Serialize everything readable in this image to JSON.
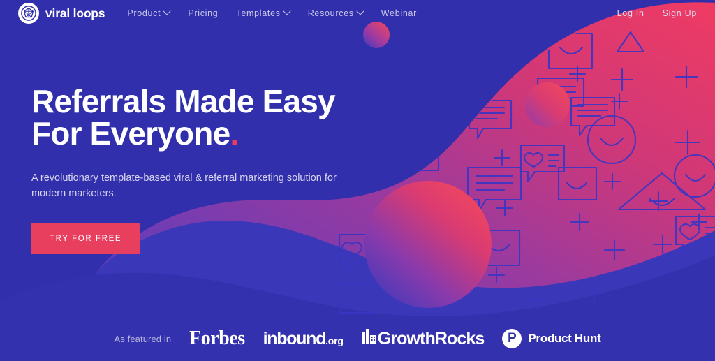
{
  "brand": {
    "name": "viral loops",
    "logo_icon": "gem-logo-icon"
  },
  "nav": {
    "main": [
      {
        "label": "Product",
        "has_dropdown": true
      },
      {
        "label": "Pricing",
        "has_dropdown": false
      },
      {
        "label": "Templates",
        "has_dropdown": true
      },
      {
        "label": "Resources",
        "has_dropdown": true
      },
      {
        "label": "Webinar",
        "has_dropdown": false
      }
    ],
    "right": [
      {
        "label": "Log In"
      },
      {
        "label": "Sign Up"
      }
    ]
  },
  "hero": {
    "headline_line1": "Referrals Made Easy",
    "headline_line2": "For Everyone",
    "headline_dot": ".",
    "subtitle": "A revolutionary template-based viral & referral marketing solution for modern marketers.",
    "cta_label": "TRY FOR FREE"
  },
  "featured": {
    "label": "As featured in",
    "logos": [
      {
        "name": "Forbes"
      },
      {
        "name": "inbound",
        "tld": ".org"
      },
      {
        "name": "GrowthRocks"
      },
      {
        "name": "Product Hunt",
        "badge": "P"
      }
    ]
  },
  "colors": {
    "background": "#312fab",
    "accent_pink": "#e83f5f",
    "blob_pink": "#e8386a",
    "blob_purple": "#8e3ba0",
    "nav_text": "#c9c8ea",
    "white": "#ffffff"
  }
}
